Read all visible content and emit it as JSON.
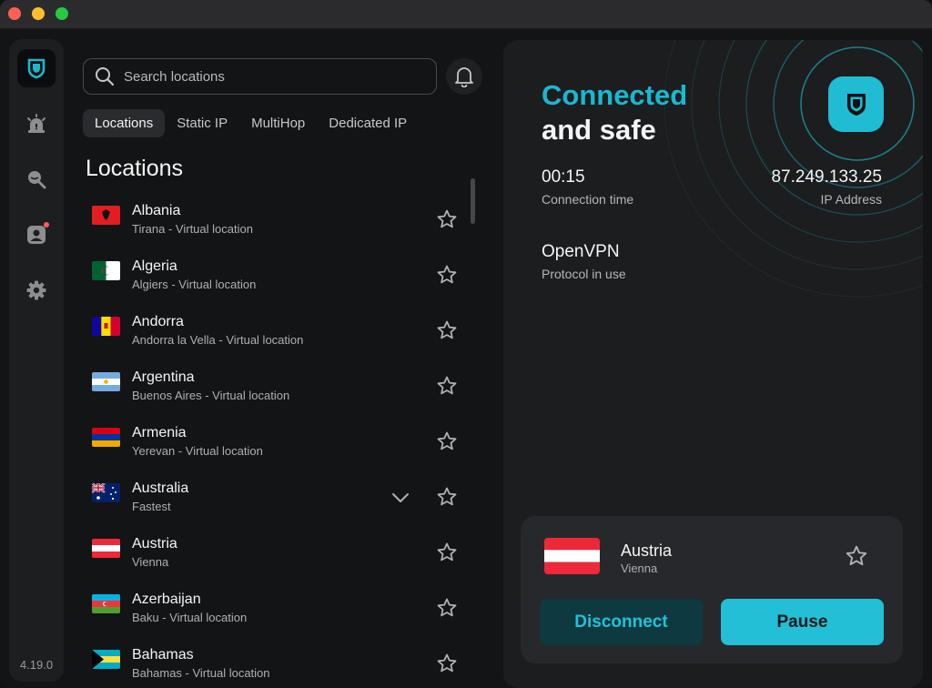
{
  "app": {
    "version": "4.19.0"
  },
  "search": {
    "placeholder": "Search locations"
  },
  "tabs": [
    {
      "label": "Locations",
      "active": true
    },
    {
      "label": "Static IP",
      "active": false
    },
    {
      "label": "MultiHop",
      "active": false
    },
    {
      "label": "Dedicated IP",
      "active": false
    }
  ],
  "locations_heading": "Locations",
  "locations": [
    {
      "name": "Albania",
      "sub": "Tirana - Virtual location",
      "flag": "albania"
    },
    {
      "name": "Algeria",
      "sub": "Algiers - Virtual location",
      "flag": "algeria"
    },
    {
      "name": "Andorra",
      "sub": "Andorra la Vella - Virtual location",
      "flag": "andorra"
    },
    {
      "name": "Argentina",
      "sub": "Buenos Aires - Virtual location",
      "flag": "argentina"
    },
    {
      "name": "Armenia",
      "sub": "Yerevan - Virtual location",
      "flag": "armenia"
    },
    {
      "name": "Australia",
      "sub": "Fastest",
      "flag": "australia",
      "expandable": true
    },
    {
      "name": "Austria",
      "sub": "Vienna",
      "flag": "austria"
    },
    {
      "name": "Azerbaijan",
      "sub": "Baku - Virtual location",
      "flag": "azerbaijan"
    },
    {
      "name": "Bahamas",
      "sub": "Bahamas - Virtual location",
      "flag": "bahamas"
    }
  ],
  "status": {
    "line1": "Connected",
    "line2": "and safe",
    "connection_time": "00:15",
    "connection_time_label": "Connection time",
    "ip": "87.249.133.25",
    "ip_label": "IP Address",
    "protocol": "OpenVPN",
    "protocol_label": "Protocol in use"
  },
  "current": {
    "country": "Austria",
    "city": "Vienna",
    "flag": "austria",
    "disconnect_label": "Disconnect",
    "pause_label": "Pause"
  },
  "colors": {
    "accent": "#1ab8d0",
    "panel": "#1c1d1f",
    "background": "#131415"
  },
  "icons": {
    "logo": "shield-icon",
    "sidebar": [
      "alarm-icon",
      "search-eye-icon",
      "account-icon",
      "gear-icon"
    ],
    "bell": "bell-icon",
    "star": "star-icon",
    "chevron": "chevron-down-icon"
  }
}
